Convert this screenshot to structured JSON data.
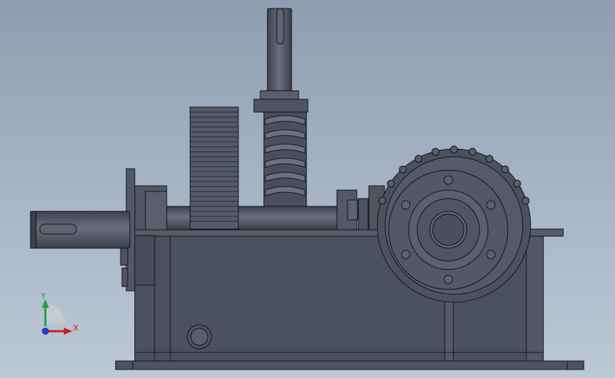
{
  "viewport": {
    "background_top": "#8e9db0",
    "background_bottom": "#bcc8d5",
    "model_fill": "#4e5361",
    "model_fill_light": "#5d6270",
    "edge_color": "#111318"
  },
  "triad": {
    "x_axis_label": "X",
    "y_axis_label": "Y",
    "x_color": "#d11a1a",
    "y_color": "#1aa33a",
    "z_color": "#2a3ad1"
  }
}
